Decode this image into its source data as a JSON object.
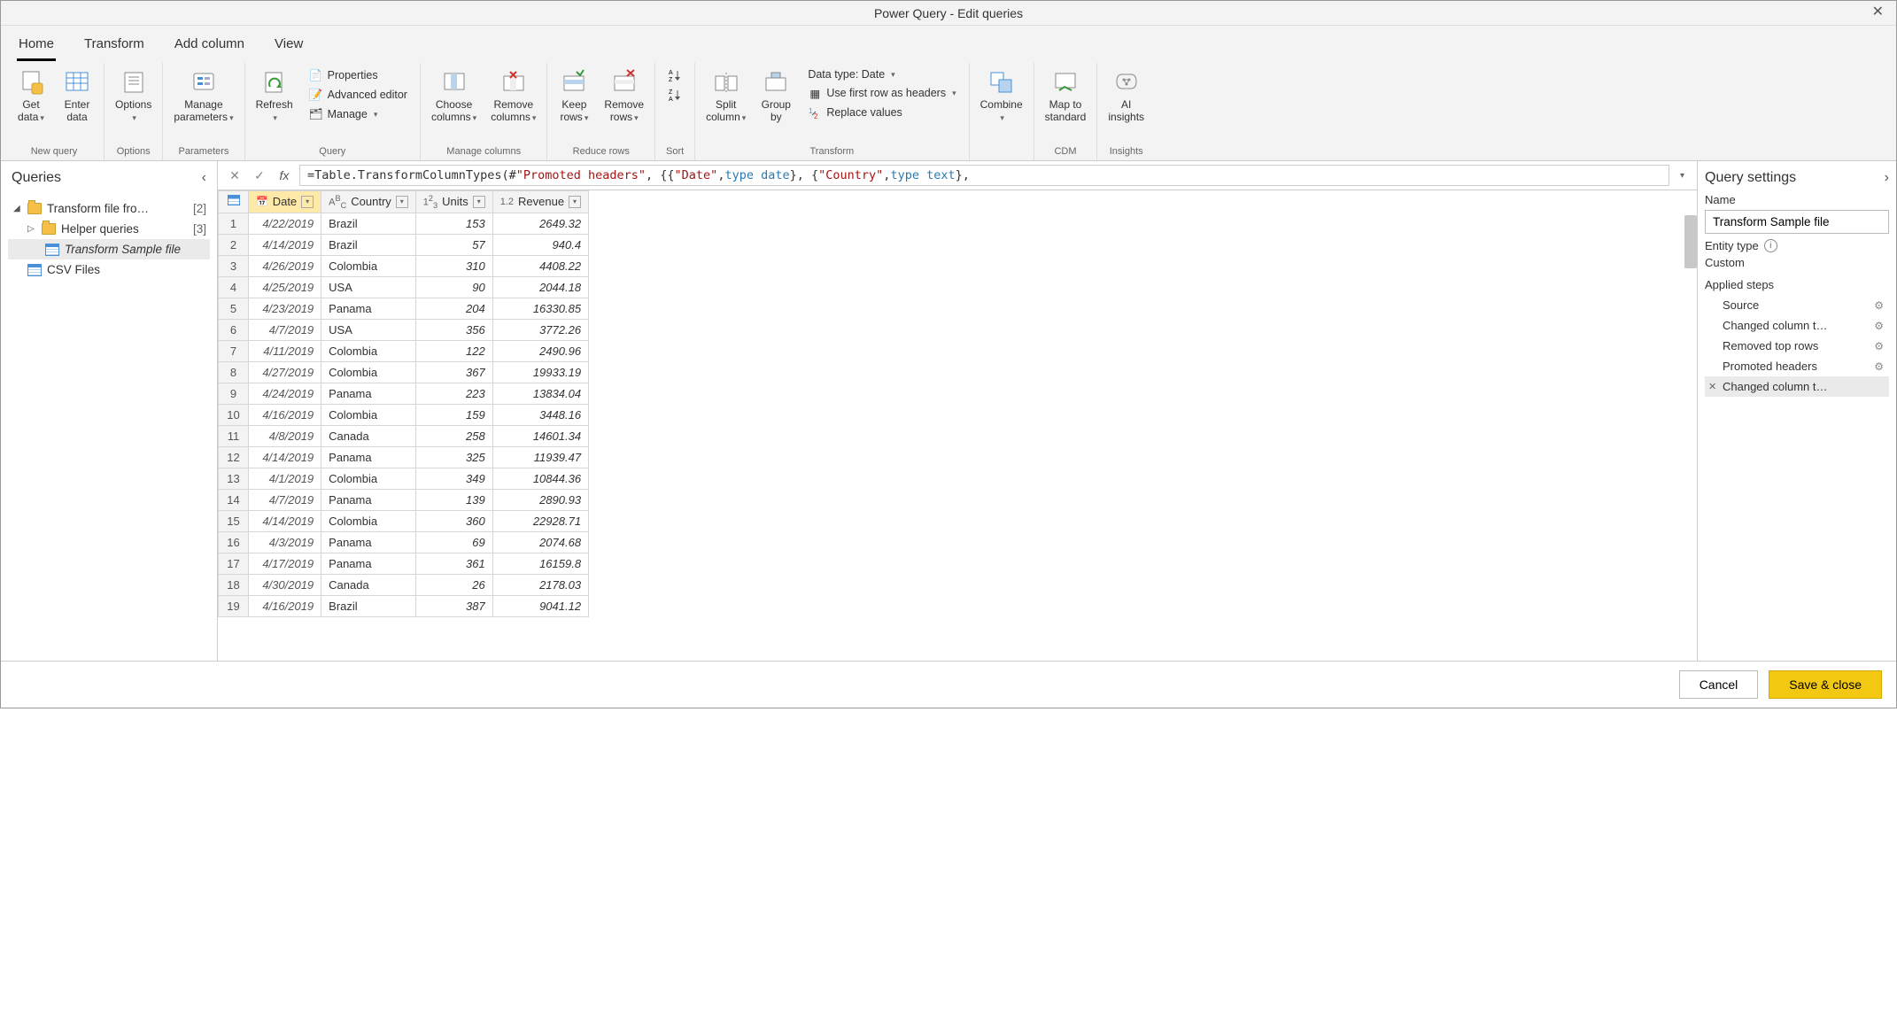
{
  "title": "Power Query - Edit queries",
  "menu_tabs": [
    "Home",
    "Transform",
    "Add column",
    "View"
  ],
  "ribbon": {
    "get_data": "Get\ndata",
    "enter_data": "Enter\ndata",
    "options": "Options",
    "manage_params": "Manage\nparameters",
    "refresh": "Refresh",
    "properties": "Properties",
    "adv_editor": "Advanced editor",
    "manage": "Manage",
    "choose_cols": "Choose\ncolumns",
    "remove_cols": "Remove\ncolumns",
    "keep_rows": "Keep\nrows",
    "remove_rows": "Remove\nrows",
    "split_col": "Split\ncolumn",
    "group_by": "Group\nby",
    "data_type": "Data type: Date",
    "first_row": "Use first row as headers",
    "replace_vals": "Replace values",
    "combine": "Combine",
    "map_std": "Map to\nstandard",
    "ai": "AI\ninsights",
    "groups": {
      "new_query": "New query",
      "options": "Options",
      "parameters": "Parameters",
      "query": "Query",
      "manage_cols": "Manage columns",
      "reduce_rows": "Reduce rows",
      "sort": "Sort",
      "transform": "Transform",
      "cdm": "CDM",
      "insights": "Insights"
    }
  },
  "queries": {
    "title": "Queries",
    "items": [
      {
        "label": "Transform file fro…",
        "count": "[2]",
        "type": "folder",
        "level": 1,
        "expanded": true
      },
      {
        "label": "Helper queries",
        "count": "[3]",
        "type": "folder",
        "level": 2,
        "expanded": false
      },
      {
        "label": "Transform Sample file",
        "type": "table",
        "level": 3,
        "selected": true
      },
      {
        "label": "CSV Files",
        "type": "table",
        "level": 2
      }
    ]
  },
  "formula": {
    "prefix": "= ",
    "t1": "Table.TransformColumnTypes(#",
    "s1": "\"Promoted headers\"",
    "t2": ", {{",
    "s2": "\"Date\"",
    "t3": ", ",
    "k1": "type date",
    "t4": "}, {",
    "s3": "\"Country\"",
    "t5": ", ",
    "k2": "type text",
    "t6": "},"
  },
  "columns": [
    {
      "name": "Date",
      "type": "date",
      "selected": true
    },
    {
      "name": "Country",
      "type": "text"
    },
    {
      "name": "Units",
      "type": "int"
    },
    {
      "name": "Revenue",
      "type": "dec"
    }
  ],
  "rows": [
    {
      "n": 1,
      "date": "4/22/2019",
      "country": "Brazil",
      "units": "153",
      "rev": "2649.32"
    },
    {
      "n": 2,
      "date": "4/14/2019",
      "country": "Brazil",
      "units": "57",
      "rev": "940.4"
    },
    {
      "n": 3,
      "date": "4/26/2019",
      "country": "Colombia",
      "units": "310",
      "rev": "4408.22"
    },
    {
      "n": 4,
      "date": "4/25/2019",
      "country": "USA",
      "units": "90",
      "rev": "2044.18"
    },
    {
      "n": 5,
      "date": "4/23/2019",
      "country": "Panama",
      "units": "204",
      "rev": "16330.85"
    },
    {
      "n": 6,
      "date": "4/7/2019",
      "country": "USA",
      "units": "356",
      "rev": "3772.26"
    },
    {
      "n": 7,
      "date": "4/11/2019",
      "country": "Colombia",
      "units": "122",
      "rev": "2490.96"
    },
    {
      "n": 8,
      "date": "4/27/2019",
      "country": "Colombia",
      "units": "367",
      "rev": "19933.19"
    },
    {
      "n": 9,
      "date": "4/24/2019",
      "country": "Panama",
      "units": "223",
      "rev": "13834.04"
    },
    {
      "n": 10,
      "date": "4/16/2019",
      "country": "Colombia",
      "units": "159",
      "rev": "3448.16"
    },
    {
      "n": 11,
      "date": "4/8/2019",
      "country": "Canada",
      "units": "258",
      "rev": "14601.34"
    },
    {
      "n": 12,
      "date": "4/14/2019",
      "country": "Panama",
      "units": "325",
      "rev": "11939.47"
    },
    {
      "n": 13,
      "date": "4/1/2019",
      "country": "Colombia",
      "units": "349",
      "rev": "10844.36"
    },
    {
      "n": 14,
      "date": "4/7/2019",
      "country": "Panama",
      "units": "139",
      "rev": "2890.93"
    },
    {
      "n": 15,
      "date": "4/14/2019",
      "country": "Colombia",
      "units": "360",
      "rev": "22928.71"
    },
    {
      "n": 16,
      "date": "4/3/2019",
      "country": "Panama",
      "units": "69",
      "rev": "2074.68"
    },
    {
      "n": 17,
      "date": "4/17/2019",
      "country": "Panama",
      "units": "361",
      "rev": "16159.8"
    },
    {
      "n": 18,
      "date": "4/30/2019",
      "country": "Canada",
      "units": "26",
      "rev": "2178.03"
    },
    {
      "n": 19,
      "date": "4/16/2019",
      "country": "Brazil",
      "units": "387",
      "rev": "9041.12"
    }
  ],
  "settings": {
    "title": "Query settings",
    "name_label": "Name",
    "name_value": "Transform Sample file",
    "entity_label": "Entity type",
    "entity_value": "Custom",
    "steps_label": "Applied steps",
    "steps": [
      {
        "label": "Source",
        "gear": true
      },
      {
        "label": "Changed column t…",
        "gear": true
      },
      {
        "label": "Removed top rows",
        "gear": true
      },
      {
        "label": "Promoted headers",
        "gear": true
      },
      {
        "label": "Changed column t…",
        "gear": false,
        "selected": true
      }
    ]
  },
  "footer": {
    "cancel": "Cancel",
    "save": "Save & close"
  }
}
